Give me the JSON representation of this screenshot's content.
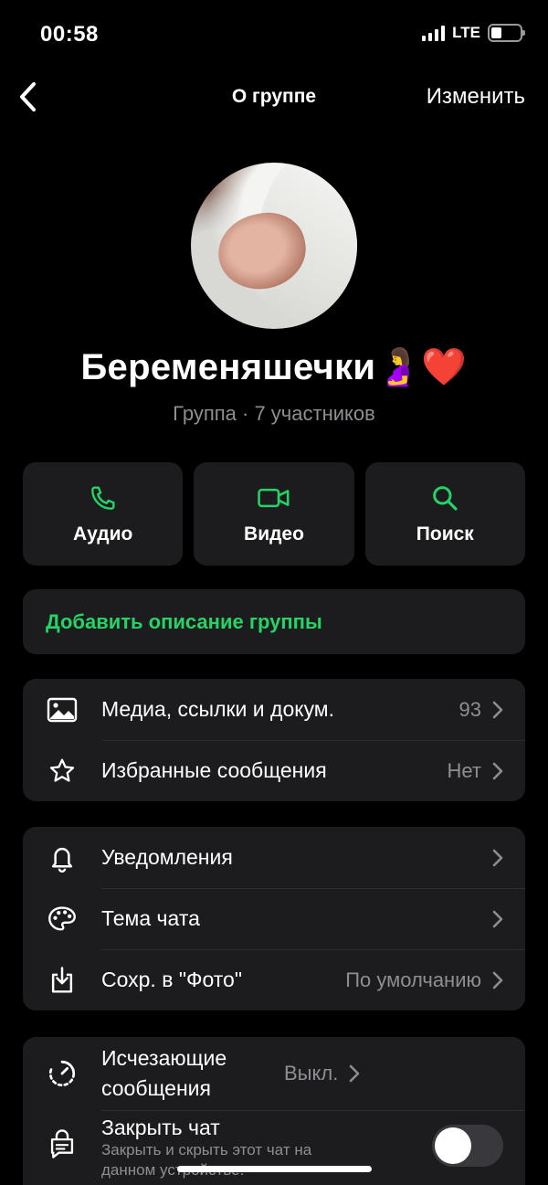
{
  "status_bar": {
    "time": "00:58",
    "network": "LTE",
    "battery_level": 0.35
  },
  "nav": {
    "title": "О группе",
    "edit_label": "Изменить"
  },
  "group": {
    "name": "Беременяшечки🤰❤️",
    "subtitle": "Группа · 7 участников"
  },
  "actions": [
    {
      "label": "Аудио",
      "icon": "phone-icon"
    },
    {
      "label": "Видео",
      "icon": "video-camera-icon"
    },
    {
      "label": "Поиск",
      "icon": "search-icon"
    }
  ],
  "description_prompt": "Добавить описание группы",
  "media_section": [
    {
      "label": "Медиа, ссылки и докум.",
      "value": "93",
      "icon": "photo-icon"
    },
    {
      "label": "Избранные сообщения",
      "value": "Нет",
      "icon": "star-icon"
    }
  ],
  "settings_section": [
    {
      "label": "Уведомления",
      "value": "",
      "icon": "bell-icon"
    },
    {
      "label": "Тема чата",
      "value": "",
      "icon": "palette-icon"
    },
    {
      "label": "Сохр. в \"Фото\"",
      "value": "По умолчанию",
      "icon": "save-download-icon"
    }
  ],
  "privacy_section": {
    "disappearing": {
      "label": "Исчезающие сообщения",
      "value": "Выкл.",
      "icon": "timer-icon"
    },
    "lock_chat": {
      "label": "Закрыть чат",
      "sublabel": "Закрыть и скрыть этот чат на данном устройстве.",
      "enabled": false,
      "icon": "lock-chat-icon"
    }
  },
  "colors": {
    "accent": "#25d366",
    "card": "#1c1c1e",
    "secondary_text": "#8e8e93"
  }
}
